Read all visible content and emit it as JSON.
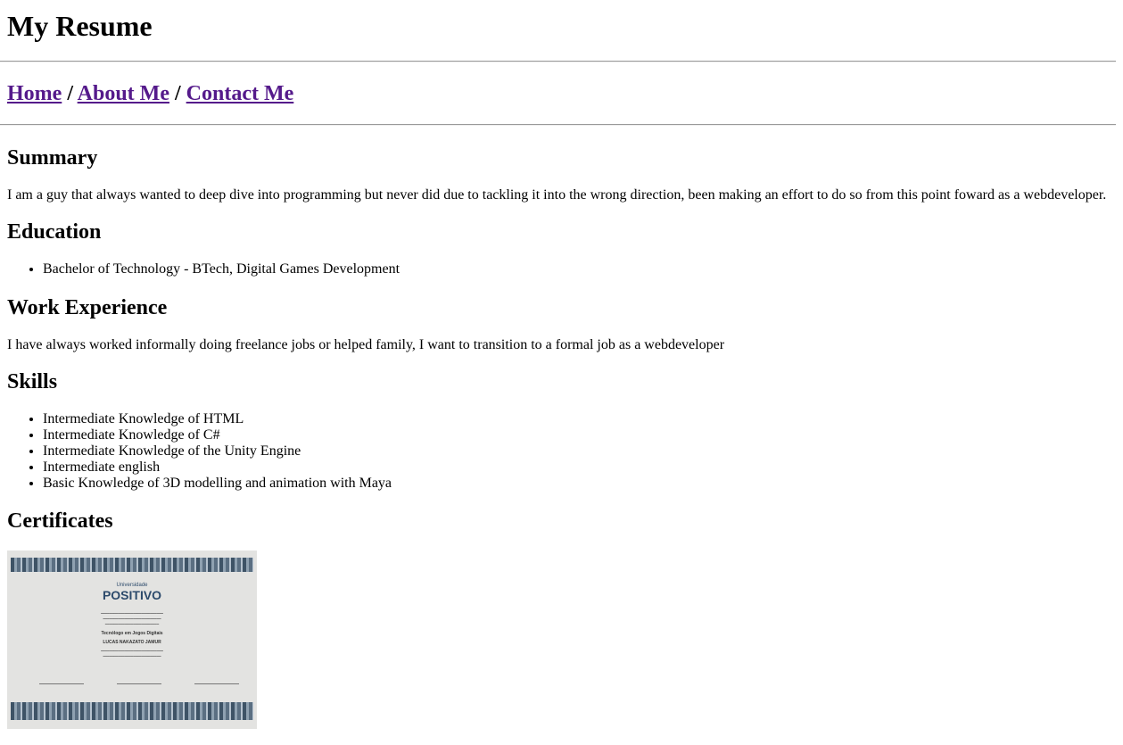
{
  "header": {
    "title": "My Resume"
  },
  "nav": {
    "home": "Home",
    "sep1": " / ",
    "about": "About Me",
    "sep2": " / ",
    "contact": "Contact Me"
  },
  "summary": {
    "heading": "Summary",
    "text": "I am a guy that always wanted to deep dive into programming but never did due to tackling it into the wrong direction, been making an effort to do so from this point foward as a webdeveloper."
  },
  "education": {
    "heading": "Education",
    "items": [
      "Bachelor of Technology - BTech, Digital Games Development"
    ]
  },
  "work": {
    "heading": "Work Experience",
    "text": "I have always worked informally doing freelance jobs or helped family, I want to transition to a formal job as a webdeveloper"
  },
  "skills": {
    "heading": "Skills",
    "items": [
      "Intermediate Knowledge of HTML",
      "Intermediate Knowledge of C#",
      "Intermediate Knowledge of the Unity Engine",
      "Intermediate english",
      "Basic Knowledge of 3D modelling and animation with Maya"
    ]
  },
  "certificates": {
    "heading": "Certificates",
    "image": {
      "logo_small": "Universidade",
      "logo_main": "POSITIVO",
      "degree": "Tecnólogo em Jogos Digitais",
      "name": "LUCAS NAKAZATO JAMUR"
    }
  }
}
